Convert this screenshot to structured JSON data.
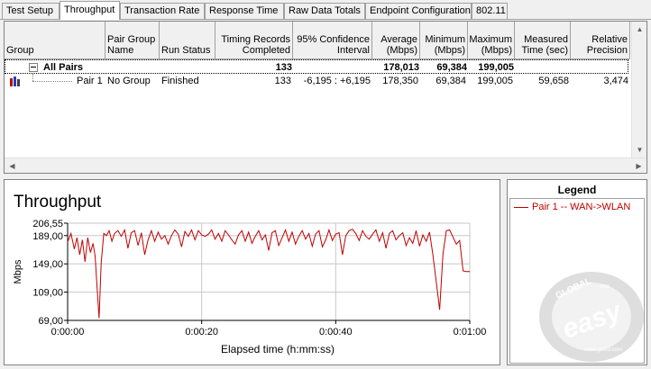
{
  "tabs": [
    {
      "label": "Test Setup",
      "active": false
    },
    {
      "label": "Throughput",
      "active": true
    },
    {
      "label": "Transaction Rate",
      "active": false
    },
    {
      "label": "Response Time",
      "active": false
    },
    {
      "label": "Raw Data Totals",
      "active": false
    },
    {
      "label": "Endpoint Configuration",
      "active": false
    },
    {
      "label": "802.11",
      "active": false
    }
  ],
  "grid": {
    "headers": {
      "group": "Group",
      "pair_group_name": "Pair Group\nName",
      "run_status": "Run Status",
      "timing_records": "Timing Records\nCompleted",
      "confidence": "95% Confidence\nInterval",
      "average": "Average\n(Mbps)",
      "minimum": "Minimum\n(Mbps)",
      "maximum": "Maximum\n(Mbps)",
      "measured_time": "Measured\nTime (sec)",
      "relative_precision": "Relative\nPrecision"
    },
    "summary_row": {
      "label": "All Pairs",
      "timing_records": "133",
      "average": "178,013",
      "minimum": "69,384",
      "maximum": "199,005"
    },
    "pair_row": {
      "group": "Pair 1",
      "pair_group_name": "No Group",
      "run_status": "Finished",
      "timing_records": "133",
      "confidence": "-6,195 : +6,195",
      "average": "178,350",
      "minimum": "69,384",
      "maximum": "199,005",
      "measured_time": "59,658",
      "relative_precision": "3,474"
    }
  },
  "chart": {
    "title": "Throughput",
    "line_color": "#c00000"
  },
  "legend": {
    "title": "Legend",
    "entries": [
      {
        "label": "Pair 1 -- WAN->WLAN",
        "color": "#c00000"
      }
    ]
  },
  "watermark": {
    "top_text": "GLOBAL",
    "small_text": "mo",
    "brand": "easy",
    "url": "www.geeid.com"
  },
  "chart_data": {
    "type": "line",
    "title": "Throughput",
    "xlabel": "Elapsed time (h:mm:ss)",
    "ylabel": "Mbps",
    "ylim": [
      69.0,
      206.55
    ],
    "xlim": [
      0,
      60
    ],
    "y_ticks": [
      "69,00",
      "109,00",
      "149,00",
      "189,00",
      "206,55"
    ],
    "y_tick_values": [
      69.0,
      109.0,
      149.0,
      189.0,
      206.55
    ],
    "x_ticks": [
      "0:00:00",
      "0:00:20",
      "0:00:40",
      "0:01:00"
    ],
    "x_tick_values": [
      0,
      20,
      40,
      60
    ],
    "grid": true,
    "series": [
      {
        "name": "Pair 1 -- WAN->WLAN",
        "x": [
          0.0,
          0.5,
          1.0,
          1.4,
          1.8,
          2.2,
          2.6,
          3.0,
          3.4,
          3.8,
          4.1,
          4.4,
          4.7,
          5.0,
          5.4,
          5.8,
          6.2,
          6.6,
          7.0,
          7.5,
          8.0,
          8.5,
          9.0,
          9.5,
          10.0,
          10.5,
          11.0,
          11.5,
          12.0,
          12.5,
          13.0,
          13.5,
          14.0,
          14.5,
          15.0,
          15.5,
          16.0,
          16.5,
          17.0,
          17.5,
          18.0,
          18.5,
          19.0,
          19.5,
          20.0,
          20.5,
          21.0,
          21.5,
          22.0,
          22.5,
          23.0,
          23.5,
          24.0,
          24.5,
          25.0,
          25.5,
          26.0,
          26.5,
          27.0,
          27.5,
          28.0,
          28.5,
          29.0,
          29.5,
          30.0,
          30.5,
          31.0,
          31.5,
          32.0,
          32.5,
          33.0,
          33.5,
          34.0,
          34.5,
          35.0,
          35.5,
          36.0,
          36.5,
          37.0,
          37.5,
          38.0,
          38.5,
          39.0,
          39.5,
          40.0,
          40.5,
          41.0,
          41.5,
          42.0,
          42.5,
          43.0,
          43.5,
          44.0,
          44.5,
          45.0,
          45.5,
          46.0,
          46.5,
          47.0,
          47.5,
          48.0,
          48.5,
          49.0,
          49.5,
          50.0,
          50.5,
          51.0,
          51.5,
          52.0,
          52.5,
          53.0,
          53.5,
          54.0,
          54.5,
          55.0,
          55.5,
          56.0,
          56.5,
          57.0,
          57.5,
          58.0,
          58.5,
          59.0,
          59.5,
          60.0
        ],
        "values": [
          180,
          192,
          170,
          186,
          162,
          183,
          152,
          186,
          165,
          178,
          160,
          115,
          72,
          150,
          192,
          189,
          196,
          181,
          192,
          196,
          188,
          197,
          171,
          193,
          196,
          175,
          193,
          162,
          183,
          196,
          181,
          194,
          184,
          189,
          177,
          189,
          197,
          191,
          173,
          195,
          188,
          197,
          183,
          196,
          190,
          188,
          191,
          197,
          184,
          192,
          181,
          196,
          190,
          183,
          177,
          190,
          196,
          181,
          194,
          178,
          188,
          196,
          183,
          190,
          168,
          193,
          196,
          175,
          186,
          197,
          181,
          194,
          177,
          188,
          196,
          184,
          192,
          174,
          191,
          196,
          173,
          183,
          197,
          182,
          191,
          193,
          162,
          189,
          196,
          198,
          192,
          182,
          196,
          188,
          184,
          191,
          197,
          181,
          193,
          171,
          192,
          196,
          183,
          189,
          193,
          175,
          186,
          178,
          196,
          174,
          190,
          181,
          194,
          162,
          124,
          84,
          163,
          196,
          197,
          187,
          177,
          182,
          139,
          138,
          138
        ]
      }
    ]
  }
}
